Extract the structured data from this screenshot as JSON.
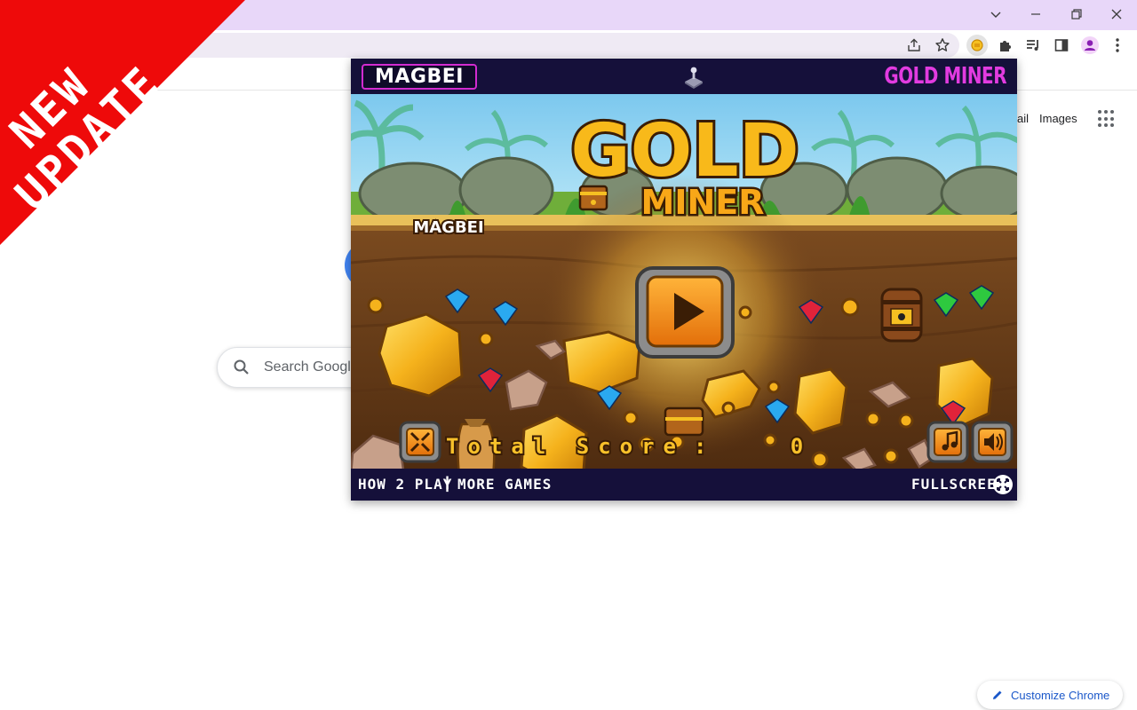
{
  "ribbon": {
    "line1": "NEW",
    "line2": "UPDATE",
    "color": "#ee0a0a"
  },
  "google": {
    "link_gmail_partial": "ail",
    "link_images": "Images",
    "search_placeholder": "Search Google"
  },
  "customize_label": "Customize Chrome",
  "popup": {
    "brand": "MAGBEI",
    "header_title": "GOLD MINER",
    "logo_line1": "GOLD",
    "logo_line2": "MINER",
    "stage_brand": "MAGBEI",
    "score_label": "Total Score",
    "score_value": "0",
    "footer": {
      "how_to_play": "HOW 2 PLAY",
      "separator": "|",
      "more_games": "MORE GAMES",
      "fullscreen": "FULLSCREEN"
    }
  },
  "colors": {
    "titlebar": "#e8d7f9",
    "popup_header": "#15103a",
    "title_magenta": "#e23be0",
    "gold": "#f6c022",
    "dirt": "#6b3f1a"
  }
}
